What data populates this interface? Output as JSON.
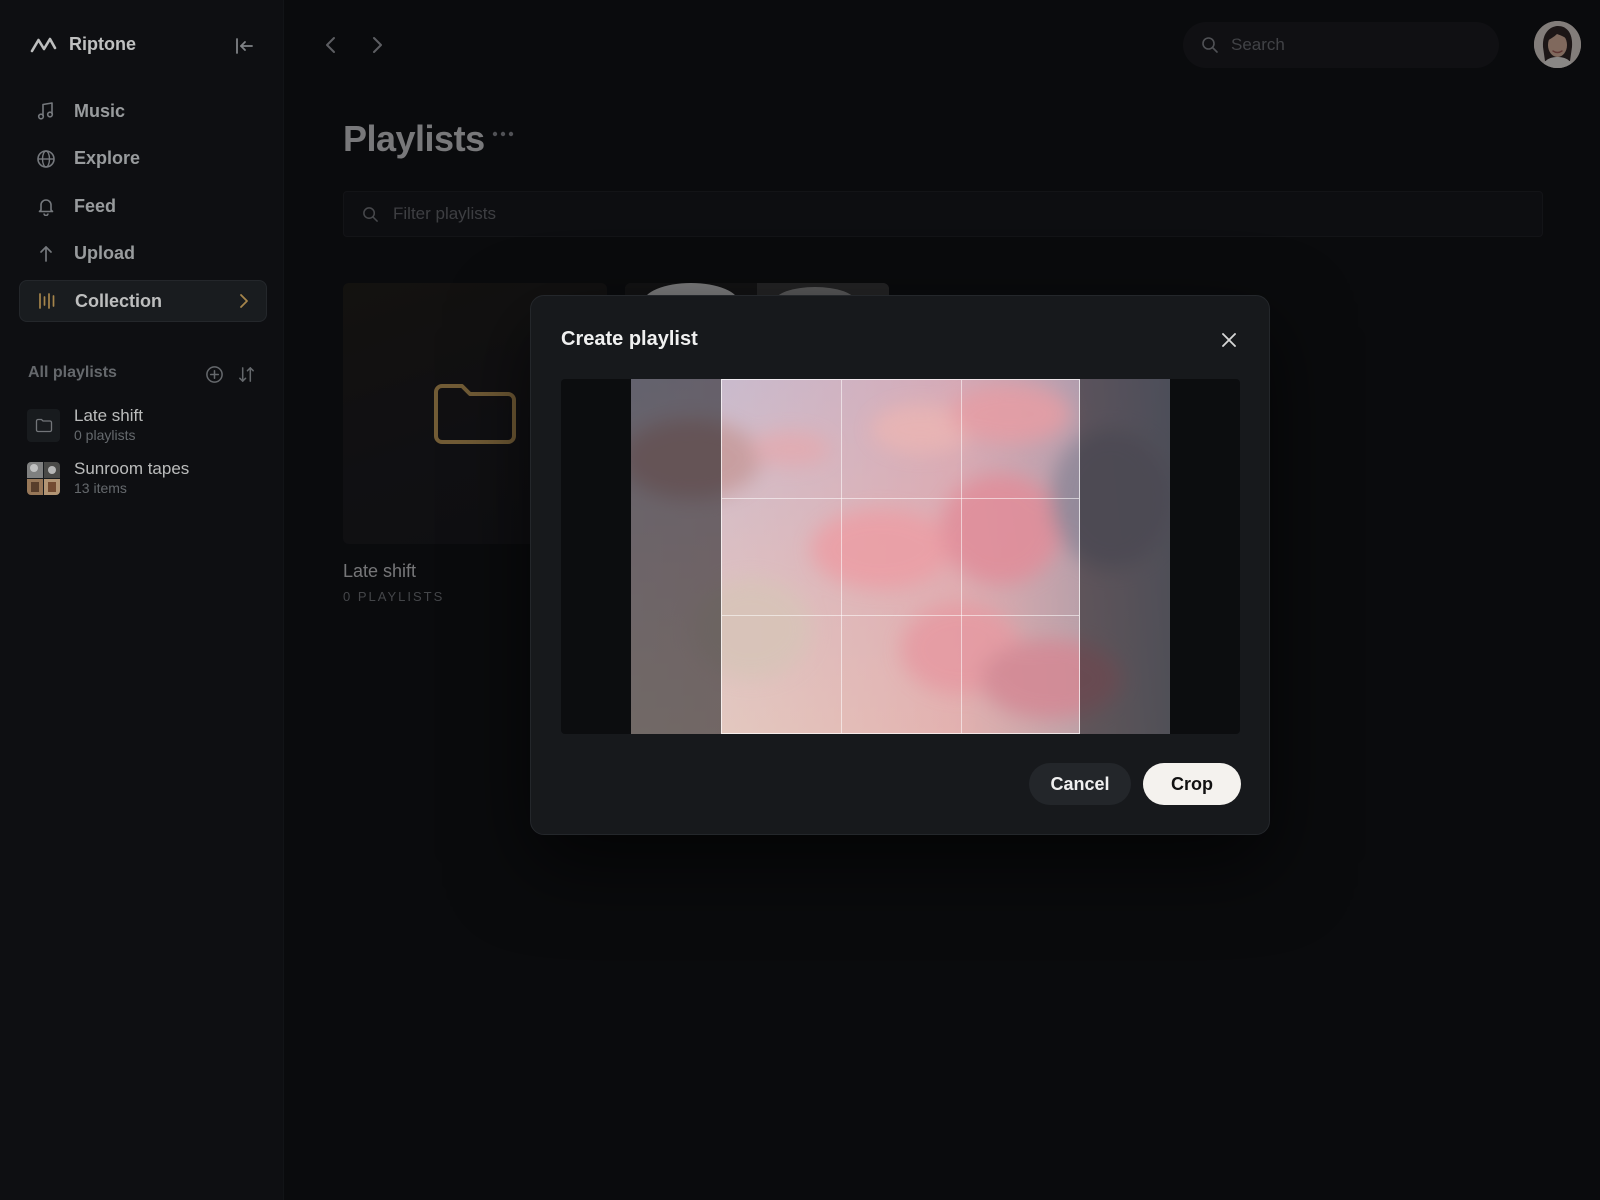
{
  "app": {
    "name": "Riptone"
  },
  "nav": {
    "items": [
      {
        "label": "Music",
        "icon": "music-note-icon"
      },
      {
        "label": "Explore",
        "icon": "globe-icon"
      },
      {
        "label": "Feed",
        "icon": "bell-icon"
      },
      {
        "label": "Upload",
        "icon": "upload-arrow-icon"
      },
      {
        "label": "Collection",
        "icon": "collection-bars-icon",
        "active": true
      }
    ]
  },
  "playlists": {
    "header": "All playlists",
    "items": [
      {
        "name": "Late shift",
        "sub": "0 playlists"
      },
      {
        "name": "Sunroom tapes",
        "sub": "13 items"
      }
    ]
  },
  "search": {
    "placeholder": "Search"
  },
  "main": {
    "title": "Playlists",
    "filter_placeholder": "Filter playlists",
    "card": {
      "title": "Late shift",
      "sub": "0 PLAYLISTS"
    }
  },
  "modal": {
    "title": "Create playlist",
    "cancel_label": "Cancel",
    "crop_label": "Crop"
  },
  "colors": {
    "accent": "#c9a05a",
    "background": "#0c0d0f",
    "sidebar": "#101114",
    "modal": "#17191c"
  }
}
